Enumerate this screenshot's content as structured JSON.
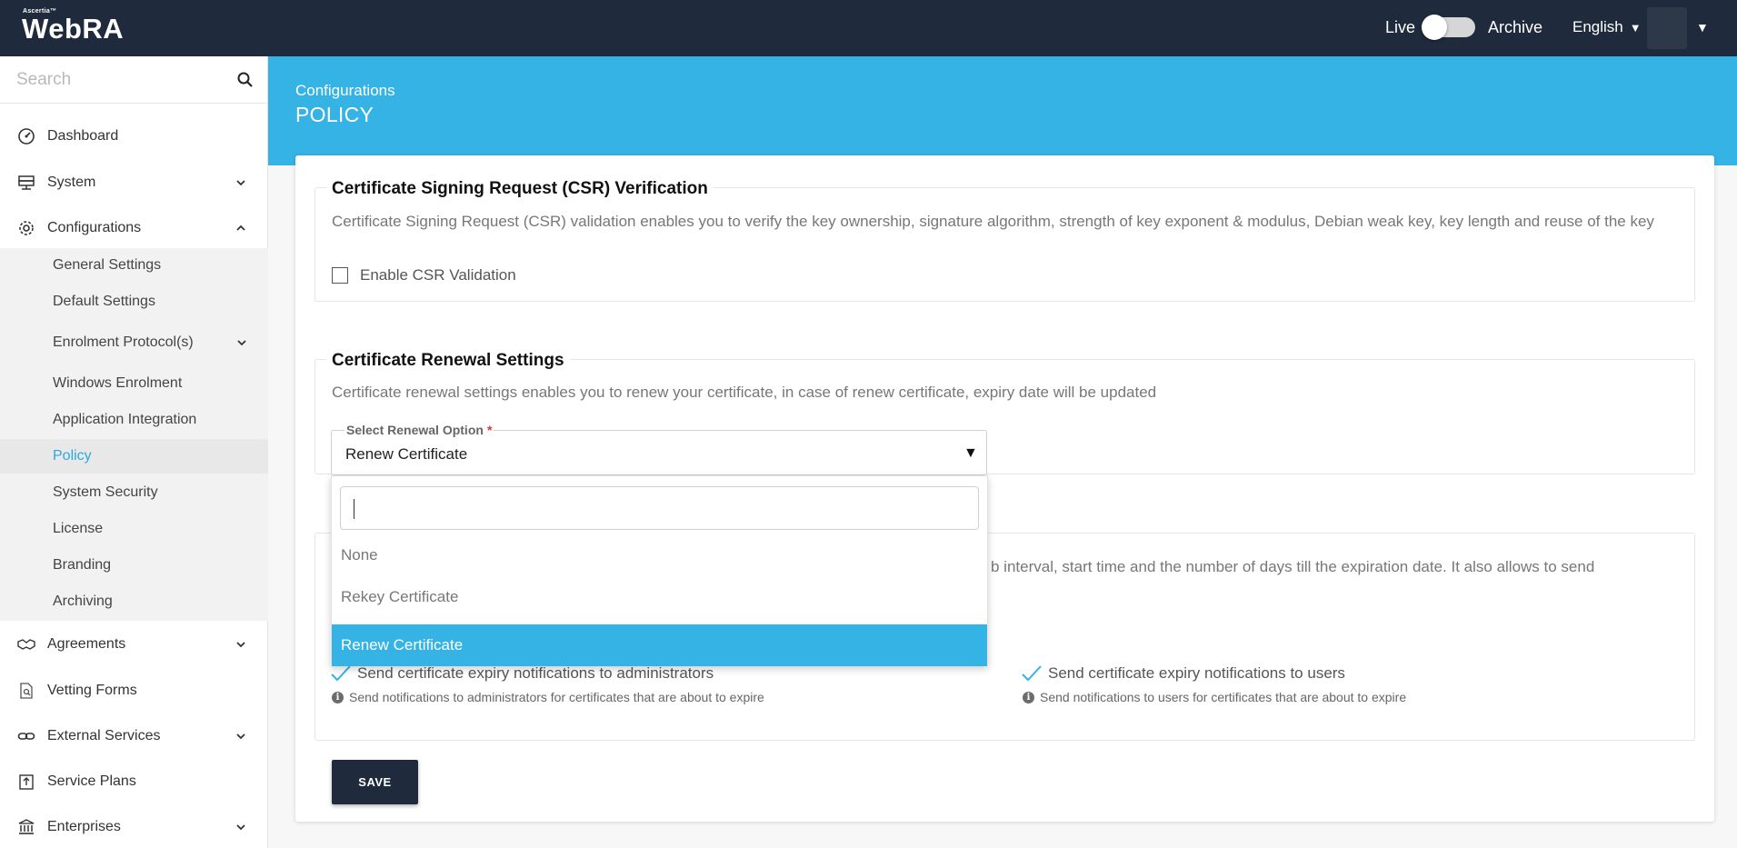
{
  "app": {
    "logo_small": "Ascertia™",
    "logo_big": "WebRA"
  },
  "topbar": {
    "live_label": "Live",
    "archive_label": "Archive",
    "language": "English"
  },
  "sidebar": {
    "search_placeholder": "Search",
    "items": {
      "dashboard": "Dashboard",
      "system": "System",
      "configurations": "Configurations",
      "agreements": "Agreements",
      "vetting_forms": "Vetting Forms",
      "external_services": "External Services",
      "service_plans": "Service Plans",
      "enterprises": "Enterprises"
    },
    "sub_items": {
      "general_settings": "General Settings",
      "default_settings": "Default Settings",
      "enrolment_protocols": "Enrolment Protocol(s)",
      "windows_enrolment": "Windows Enrolment",
      "application_integration": "Application Integration",
      "policy": "Policy",
      "system_security": "System Security",
      "license": "License",
      "branding": "Branding",
      "archiving": "Archiving"
    }
  },
  "header": {
    "breadcrumb": "Configurations",
    "title": "POLICY"
  },
  "csr": {
    "title": "Certificate Signing Request (CSR) Verification",
    "description": "Certificate Signing Request (CSR) validation enables you to verify the key ownership, signature algorithm, strength of key exponent & modulus, Debian weak key, key length and reuse of the key",
    "checkbox_label": "Enable CSR Validation"
  },
  "renewal": {
    "title": "Certificate Renewal Settings",
    "description": "Certificate renewal settings enables you to renew your certificate, in case of renew certificate, expiry date will be updated",
    "select_label": "Select Renewal Option",
    "select_value": "Renew Certificate",
    "options": [
      "None",
      "Rekey Certificate",
      "Renew Certificate"
    ]
  },
  "notifications": {
    "description_partial": "b interval, start time and the number of days till the expiration date. It also allows to send",
    "admin_label": "Send certificate expiry notifications to administrators",
    "admin_hint": "Send notifications to administrators for certificates that are about to expire",
    "users_label": "Send certificate expiry notifications to users",
    "users_hint": "Send notifications to users for certificates that are about to expire"
  },
  "actions": {
    "save_label": "SAVE"
  }
}
